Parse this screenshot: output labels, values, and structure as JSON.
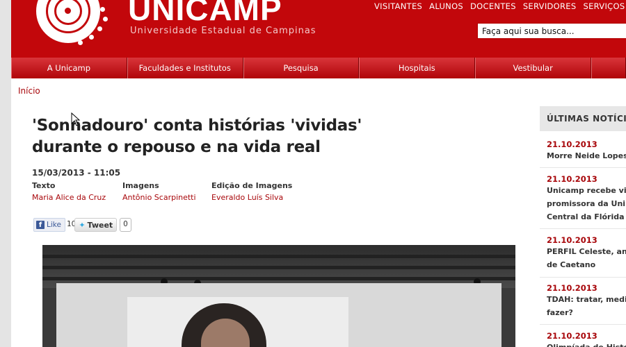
{
  "brand": {
    "title": "UNICAMP",
    "subtitle": "Universidade Estadual de Campinas"
  },
  "top_links": [
    "VISITANTES",
    "ALUNOS",
    "DOCENTES",
    "SERVIDORES",
    "SERVIÇOS"
  ],
  "search": {
    "placeholder": "Faça aqui sua busca..."
  },
  "nav": [
    "A Unicamp",
    "Faculdades e Institutos",
    "Pesquisa",
    "Hospitais",
    "Vestibular"
  ],
  "breadcrumb": "Início",
  "article": {
    "title": "'Sonhadouro' conta histórias 'vividas' durante o repouso e na vida real",
    "date": "15/03/2013 - 11:05",
    "credits": [
      {
        "label": "Texto",
        "value": "Maria Alice da Cruz"
      },
      {
        "label": "Imagens",
        "value": "Antônio Scarpinetti"
      },
      {
        "label": "Edição de Imagens",
        "value": "Everaldo Luís Silva"
      }
    ]
  },
  "social": {
    "like_label": "Like",
    "like_count": "10",
    "tweet_label": "Tweet",
    "tweet_count": "0"
  },
  "sidebar": {
    "heading": "ÚLTIMAS NOTÍCIAS",
    "news": [
      {
        "date": "21.10.2013",
        "lines": [
          "Morre Neide Lopes"
        ]
      },
      {
        "date": "21.10.2013",
        "lines": [
          "Unicamp recebe vi",
          "promissora da Uni",
          "Central da Flórida"
        ]
      },
      {
        "date": "21.10.2013",
        "lines": [
          "PERFIL Celeste, an",
          "de Caetano"
        ]
      },
      {
        "date": "21.10.2013",
        "lines": [
          "TDAH: tratar, medi",
          "fazer?"
        ]
      },
      {
        "date": "21.10.2013",
        "lines": [
          "Olimpíada de Histó"
        ]
      }
    ]
  },
  "colors": {
    "brand_red": "#c2070b",
    "link_red": "#a8070b"
  }
}
